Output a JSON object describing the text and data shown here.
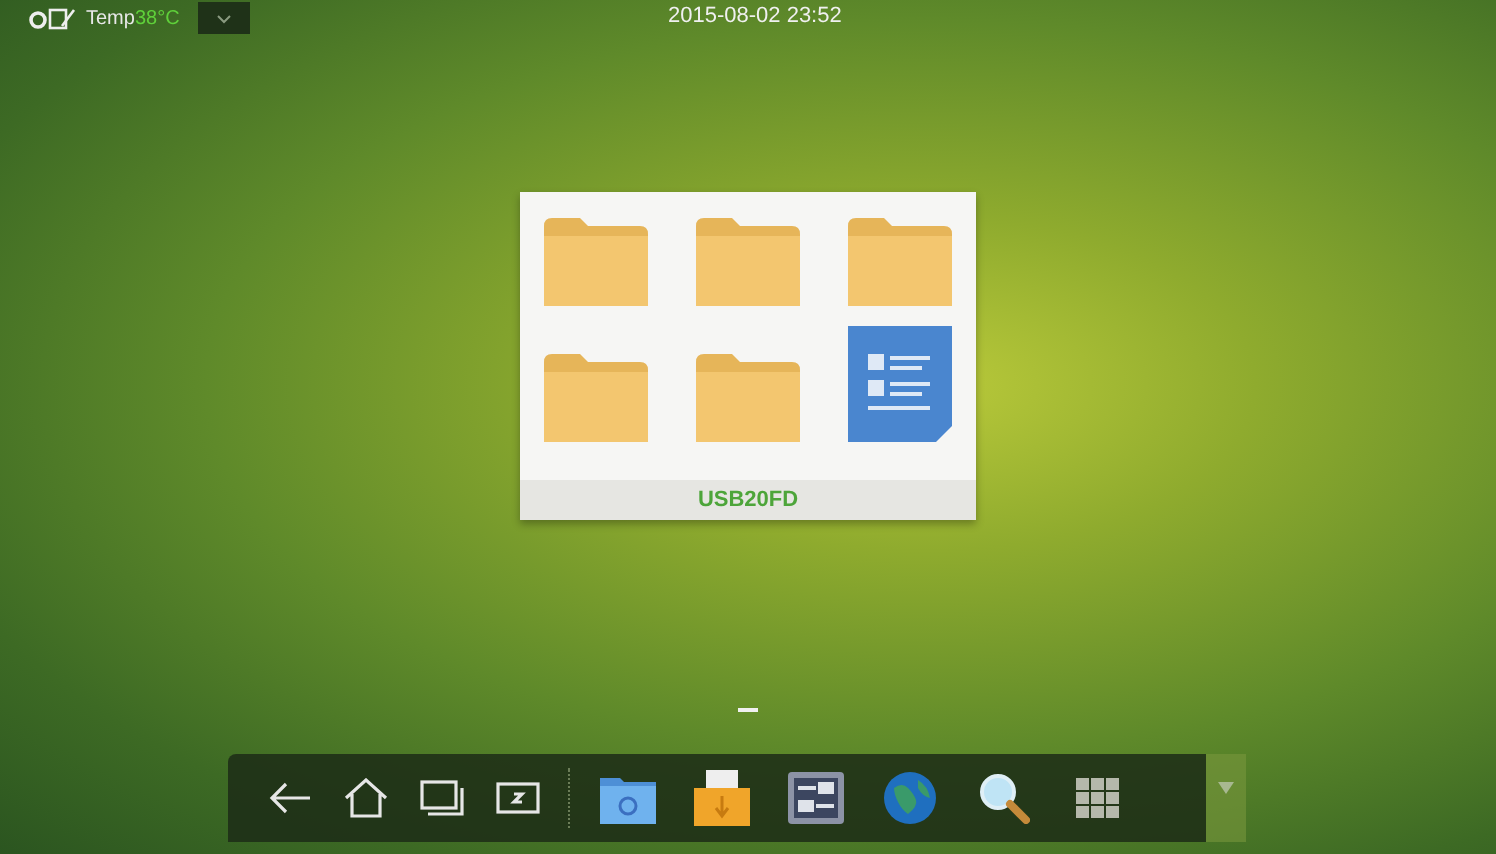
{
  "status_bar": {
    "temp_label": "Temp",
    "temp_value": "38°C",
    "datetime": "2015-08-02 23:52"
  },
  "folder": {
    "name": "USB20FD",
    "items": [
      {
        "kind": "folder"
      },
      {
        "kind": "folder"
      },
      {
        "kind": "folder"
      },
      {
        "kind": "folder"
      },
      {
        "kind": "folder"
      },
      {
        "kind": "document"
      }
    ]
  },
  "dock": {
    "nav": [
      {
        "kind": "back"
      },
      {
        "kind": "home"
      },
      {
        "kind": "recent"
      },
      {
        "kind": "screen"
      }
    ],
    "apps": [
      {
        "kind": "files"
      },
      {
        "kind": "usb"
      },
      {
        "kind": "settings"
      },
      {
        "kind": "browser"
      },
      {
        "kind": "search"
      },
      {
        "kind": "apps"
      }
    ]
  }
}
